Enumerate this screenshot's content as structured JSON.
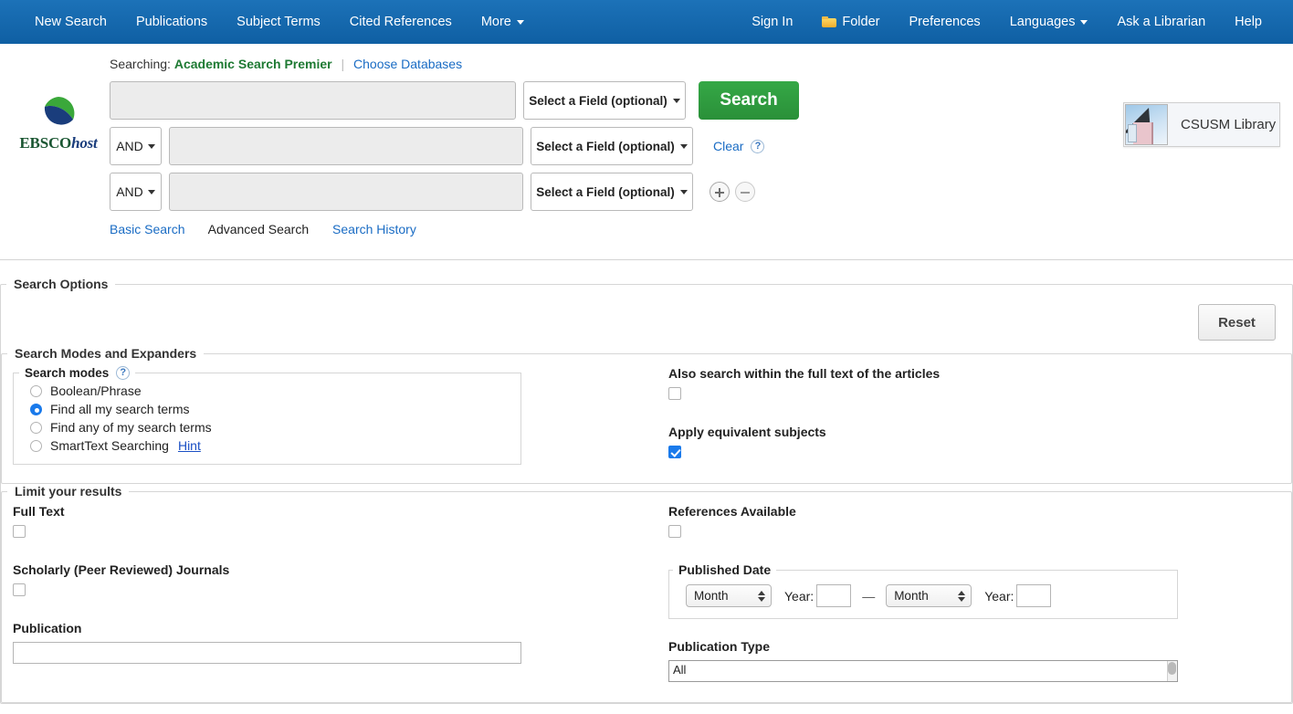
{
  "topnav": {
    "left_items": [
      {
        "label": "New Search",
        "icon": null,
        "caret": false
      },
      {
        "label": "Publications",
        "icon": null,
        "caret": false
      },
      {
        "label": "Subject Terms",
        "icon": null,
        "caret": false
      },
      {
        "label": "Cited References",
        "icon": null,
        "caret": false
      },
      {
        "label": "More",
        "icon": null,
        "caret": true
      }
    ],
    "right_items": [
      {
        "label": "Sign In",
        "icon": null,
        "caret": false
      },
      {
        "label": "Folder",
        "icon": "folder-icon",
        "caret": false
      },
      {
        "label": "Preferences",
        "icon": null,
        "caret": false
      },
      {
        "label": "Languages",
        "icon": null,
        "caret": true
      },
      {
        "label": "Ask a Librarian",
        "icon": null,
        "caret": false
      },
      {
        "label": "Help",
        "icon": null,
        "caret": false
      }
    ],
    "background_color": "#1467ab"
  },
  "brand": {
    "wordmark_bold": "EBSCO",
    "wordmark_italic": "host",
    "green": "#1a5632",
    "blue": "#1a3d7c"
  },
  "library_badge": {
    "name": "CSUSM Library"
  },
  "search": {
    "searching_prefix": "Searching:",
    "database": "Academic Search Premier",
    "choose_databases": "Choose Databases",
    "search_button": "Search",
    "clear_label": "Clear",
    "help_icon": "?",
    "field_placeholder": "",
    "rows": [
      {
        "boolean": null,
        "value": "",
        "field_label": "Select a Field (optional)"
      },
      {
        "boolean": "AND",
        "value": "",
        "field_label": "Select a Field (optional)"
      },
      {
        "boolean": "AND",
        "value": "",
        "field_label": "Select a Field (optional)"
      }
    ],
    "mode_links": [
      {
        "label": "Basic Search",
        "active": false
      },
      {
        "label": "Advanced Search",
        "active": true
      },
      {
        "label": "Search History",
        "active": false
      }
    ]
  },
  "search_options": {
    "legend": "Search Options",
    "reset_label": "Reset",
    "modes_expanders": {
      "legend": "Search Modes and Expanders",
      "search_modes_legend": "Search modes",
      "help_icon": "?",
      "modes": [
        {
          "label": "Boolean/Phrase",
          "selected": false
        },
        {
          "label": "Find all my search terms",
          "selected": true
        },
        {
          "label": "Find any of my search terms",
          "selected": false
        },
        {
          "label": "SmartText Searching",
          "selected": false,
          "hint": "Hint"
        }
      ],
      "expanders": [
        {
          "label": "Also search within the full text of the articles",
          "checked": false
        },
        {
          "label": "Apply equivalent subjects",
          "checked": true
        }
      ]
    },
    "limit_results": {
      "legend": "Limit your results",
      "left": [
        {
          "label": "Full Text",
          "type": "checkbox",
          "checked": false
        },
        {
          "label": "Scholarly (Peer Reviewed) Journals",
          "type": "checkbox",
          "checked": false
        },
        {
          "label": "Publication",
          "type": "text",
          "value": ""
        }
      ],
      "right": [
        {
          "label": "References Available",
          "type": "checkbox",
          "checked": false
        }
      ],
      "published_date": {
        "legend": "Published Date",
        "from_month": "Month",
        "from_year_label": "Year:",
        "from_year": "",
        "dash": "—",
        "to_month": "Month",
        "to_year_label": "Year:",
        "to_year": ""
      },
      "publication_type": {
        "label": "Publication Type",
        "selected": "All"
      }
    }
  }
}
